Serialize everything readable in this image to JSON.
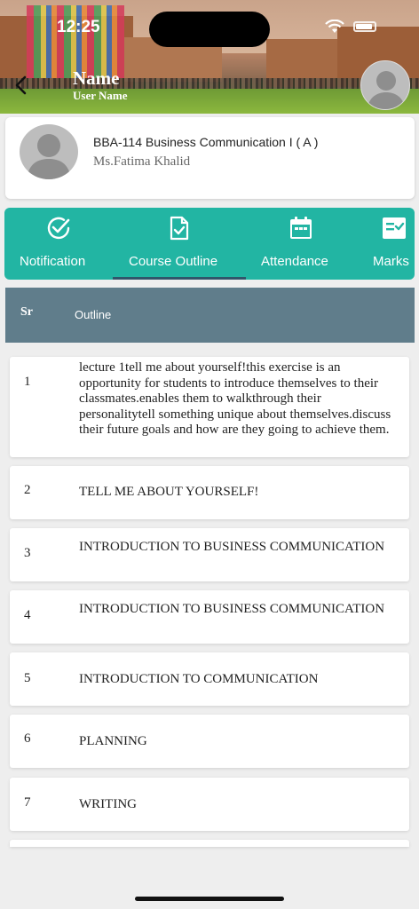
{
  "status": {
    "time": "12:25"
  },
  "header": {
    "name": "Name",
    "user_name": "User Name"
  },
  "course": {
    "title": "BBA-114 Business Communication I ( A )",
    "teacher": "Ms.Fatima Khalid"
  },
  "tabs": [
    {
      "label": "Notification",
      "icon": "check-circle-icon",
      "active": false
    },
    {
      "label": "Course Outline",
      "icon": "document-check-icon",
      "active": true
    },
    {
      "label": "Attendance",
      "icon": "calendar-icon",
      "active": false
    },
    {
      "label": "Marks",
      "icon": "checklist-icon",
      "active": false
    }
  ],
  "table": {
    "headers": {
      "sr": "Sr",
      "outline": "Outline"
    },
    "rows": [
      {
        "sr": "1",
        "outline": "lecture 1tell me about yourself!this exercise is an opportunity for students to introduce themselves to their classmates.enables them to walkthrough their personalitytell something unique about themselves.discuss their future goals and how are they going to achieve them."
      },
      {
        "sr": "2",
        "outline": "TELL ME ABOUT YOURSELF!"
      },
      {
        "sr": "3",
        "outline": "INTRODUCTION TO BUSINESS COMMUNICATION"
      },
      {
        "sr": "4",
        "outline": "INTRODUCTION TO BUSINESS COMMUNICATION"
      },
      {
        "sr": "5",
        "outline": "INTRODUCTION TO COMMUNICATION"
      },
      {
        "sr": "6",
        "outline": "PLANNING"
      },
      {
        "sr": "7",
        "outline": "WRITING"
      }
    ]
  },
  "colors": {
    "accent": "#22b5a3",
    "table_header": "#607d8b",
    "active_tab_underline": "#30566b"
  }
}
